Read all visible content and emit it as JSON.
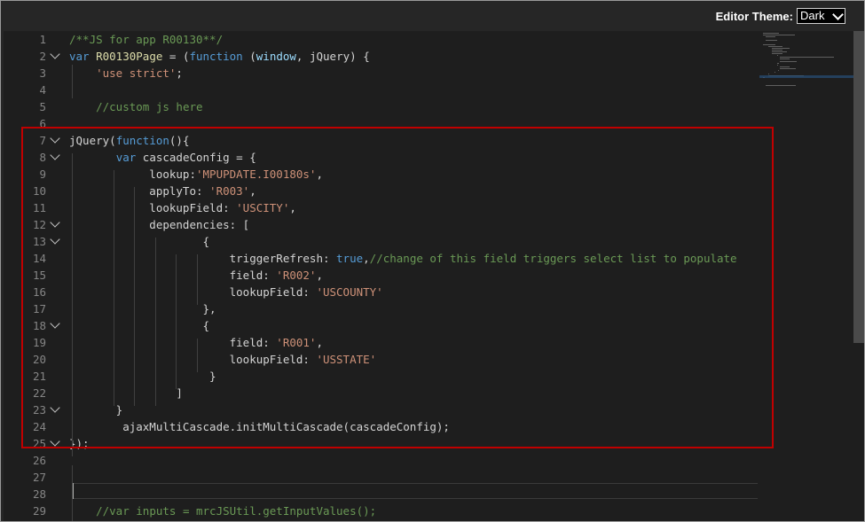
{
  "toolbar": {
    "theme_label": "Editor Theme:",
    "theme_value": "Dark"
  },
  "editor": {
    "lines": [
      {
        "n": "1",
        "fold": false,
        "tokens": [
          {
            "t": "/**JS for app R00130**/",
            "c": "comment"
          }
        ]
      },
      {
        "n": "2",
        "fold": true,
        "tokens": [
          {
            "t": "var ",
            "c": "kw"
          },
          {
            "t": "R00130Page",
            "c": "fn"
          },
          {
            "t": " = (",
            "c": "plain"
          },
          {
            "t": "function",
            "c": "kw"
          },
          {
            "t": " (",
            "c": "plain"
          },
          {
            "t": "window",
            "c": "var"
          },
          {
            "t": ", ",
            "c": "plain"
          },
          {
            "t": "jQuery",
            "c": "plain"
          },
          {
            "t": ") {",
            "c": "plain"
          }
        ]
      },
      {
        "n": "3",
        "fold": false,
        "tokens": [
          {
            "t": "    ",
            "c": "plain"
          },
          {
            "t": "'use strict'",
            "c": "str"
          },
          {
            "t": ";",
            "c": "plain"
          }
        ]
      },
      {
        "n": "4",
        "fold": false,
        "tokens": []
      },
      {
        "n": "5",
        "fold": false,
        "tokens": [
          {
            "t": "    ",
            "c": "plain"
          },
          {
            "t": "//custom js here",
            "c": "comment"
          }
        ]
      },
      {
        "n": "6",
        "fold": false,
        "tokens": []
      },
      {
        "n": "7",
        "fold": true,
        "tokens": [
          {
            "t": "jQuery",
            "c": "plain"
          },
          {
            "t": "(",
            "c": "plain"
          },
          {
            "t": "function",
            "c": "kw"
          },
          {
            "t": "(){",
            "c": "plain"
          }
        ]
      },
      {
        "n": "8",
        "fold": true,
        "tokens": [
          {
            "t": "       ",
            "c": "plain"
          },
          {
            "t": "var ",
            "c": "kw"
          },
          {
            "t": "cascadeConfig = {",
            "c": "plain"
          }
        ]
      },
      {
        "n": "9",
        "fold": false,
        "tokens": [
          {
            "t": "            lookup:",
            "c": "plain"
          },
          {
            "t": "'MPUPDATE.I00180s'",
            "c": "str"
          },
          {
            "t": ",",
            "c": "plain"
          }
        ]
      },
      {
        "n": "10",
        "fold": false,
        "tokens": [
          {
            "t": "            applyTo: ",
            "c": "plain"
          },
          {
            "t": "'R003'",
            "c": "str"
          },
          {
            "t": ",",
            "c": "plain"
          }
        ]
      },
      {
        "n": "11",
        "fold": false,
        "tokens": [
          {
            "t": "            lookupField: ",
            "c": "plain"
          },
          {
            "t": "'USCITY'",
            "c": "str"
          },
          {
            "t": ",",
            "c": "plain"
          }
        ]
      },
      {
        "n": "12",
        "fold": true,
        "tokens": [
          {
            "t": "            dependencies: [",
            "c": "plain"
          }
        ]
      },
      {
        "n": "13",
        "fold": true,
        "tokens": [
          {
            "t": "                    {",
            "c": "plain"
          }
        ]
      },
      {
        "n": "14",
        "fold": false,
        "tokens": [
          {
            "t": "                        triggerRefresh: ",
            "c": "plain"
          },
          {
            "t": "true",
            "c": "kw"
          },
          {
            "t": ",",
            "c": "plain"
          },
          {
            "t": "//change of this field triggers select list to populate",
            "c": "comment"
          }
        ]
      },
      {
        "n": "15",
        "fold": false,
        "tokens": [
          {
            "t": "                        field: ",
            "c": "plain"
          },
          {
            "t": "'R002'",
            "c": "str"
          },
          {
            "t": ",",
            "c": "plain"
          }
        ]
      },
      {
        "n": "16",
        "fold": false,
        "tokens": [
          {
            "t": "                        lookupField: ",
            "c": "plain"
          },
          {
            "t": "'USCOUNTY'",
            "c": "str"
          }
        ]
      },
      {
        "n": "17",
        "fold": false,
        "tokens": [
          {
            "t": "                    },",
            "c": "plain"
          }
        ]
      },
      {
        "n": "18",
        "fold": true,
        "tokens": [
          {
            "t": "                    {",
            "c": "plain"
          }
        ]
      },
      {
        "n": "19",
        "fold": false,
        "tokens": [
          {
            "t": "                        field: ",
            "c": "plain"
          },
          {
            "t": "'R001'",
            "c": "str"
          },
          {
            "t": ",",
            "c": "plain"
          }
        ]
      },
      {
        "n": "20",
        "fold": false,
        "tokens": [
          {
            "t": "                        lookupField: ",
            "c": "plain"
          },
          {
            "t": "'USSTATE'",
            "c": "str"
          }
        ]
      },
      {
        "n": "21",
        "fold": false,
        "tokens": [
          {
            "t": "                     }",
            "c": "plain"
          }
        ]
      },
      {
        "n": "22",
        "fold": false,
        "tokens": [
          {
            "t": "                ]",
            "c": "plain"
          }
        ]
      },
      {
        "n": "23",
        "fold": true,
        "tokens": [
          {
            "t": "       }",
            "c": "plain"
          }
        ]
      },
      {
        "n": "24",
        "fold": false,
        "tokens": [
          {
            "t": "        ajaxMultiCascade.initMultiCascade(cascadeConfig);",
            "c": "plain"
          }
        ]
      },
      {
        "n": "25",
        "fold": true,
        "tokens": [
          {
            "t": "});",
            "c": "plain"
          }
        ]
      },
      {
        "n": "26",
        "fold": false,
        "tokens": []
      },
      {
        "n": "27",
        "fold": false,
        "tokens": []
      },
      {
        "n": "28",
        "fold": false,
        "tokens": []
      },
      {
        "n": "29",
        "fold": false,
        "tokens": [
          {
            "t": "    ",
            "c": "plain"
          },
          {
            "t": "//var inputs = mrcJSUtil.getInputValues();",
            "c": "comment"
          }
        ]
      }
    ]
  },
  "colors": {
    "highlight_box": "#c00000",
    "editor_bg": "#1e1e1e",
    "frame_bg": "#262626"
  }
}
